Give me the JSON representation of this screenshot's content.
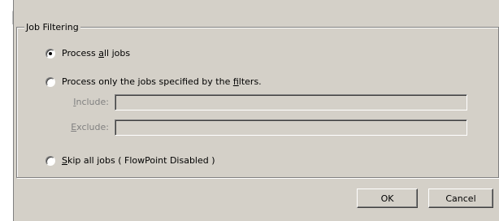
{
  "group": {
    "title": "Job Filtering"
  },
  "options": [
    {
      "pre": "Process ",
      "key": "a",
      "post": "ll jobs",
      "checked": true
    },
    {
      "pre": "Process only the jobs specified by the ",
      "key": "f",
      "post": "ilters.",
      "checked": false
    },
    {
      "pre": "",
      "key": "S",
      "post": "kip all jobs ( FlowPoint Disabled )",
      "checked": false
    }
  ],
  "include": {
    "key": "I",
    "rest": "nclude:",
    "value": ""
  },
  "exclude": {
    "key": "E",
    "rest": "xclude:",
    "value": ""
  },
  "buttons": {
    "ok": "OK",
    "cancel": "Cancel"
  }
}
